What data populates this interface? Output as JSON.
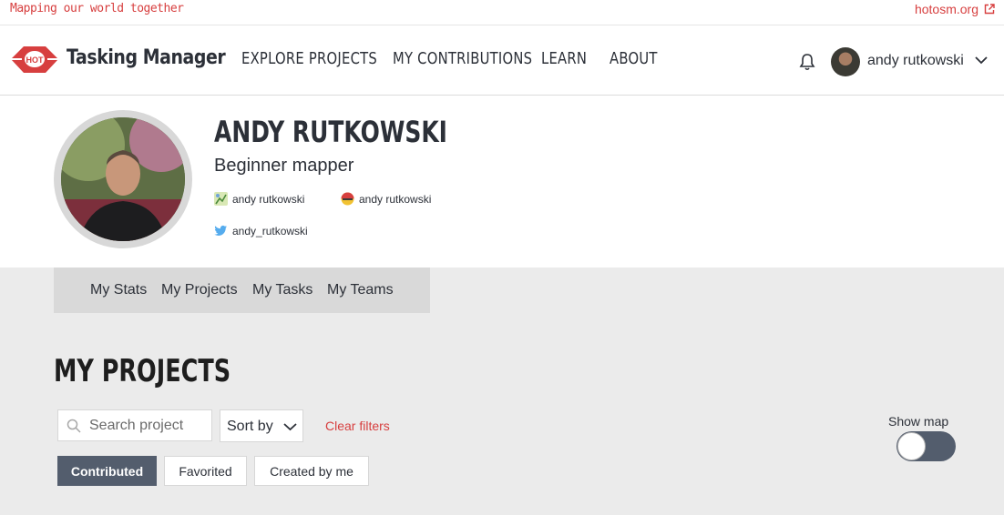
{
  "topbar": {
    "tagline": "Mapping our world together",
    "external_link": "hotosm.org"
  },
  "navbar": {
    "logo_text": "HOT",
    "brand": "Tasking Manager",
    "links": [
      "EXPLORE PROJECTS",
      "MY CONTRIBUTIONS",
      "LEARN",
      "ABOUT"
    ],
    "user_name": "andy rutkowski"
  },
  "profile": {
    "name": "ANDY RUTKOWSKI",
    "level": "Beginner mapper",
    "osm_username": "andy rutkowski",
    "osmcha_username": "andy rutkowski",
    "twitter_handle": "andy_rutkowski"
  },
  "tabs": [
    "My Stats",
    "My Projects",
    "My Tasks",
    "My Teams"
  ],
  "main": {
    "title": "MY PROJECTS",
    "search_placeholder": "Search project",
    "sort_label": "Sort by",
    "clear_filters": "Clear filters",
    "show_map_label": "Show map",
    "show_map_enabled": false,
    "filters": [
      "Contributed",
      "Favorited",
      "Created by me"
    ],
    "active_filter": "Contributed"
  },
  "colors": {
    "brand_red": "#d73f3f",
    "dark_slate": "#535d6d",
    "text": "#2c3038",
    "page_bg": "#ebebeb"
  }
}
